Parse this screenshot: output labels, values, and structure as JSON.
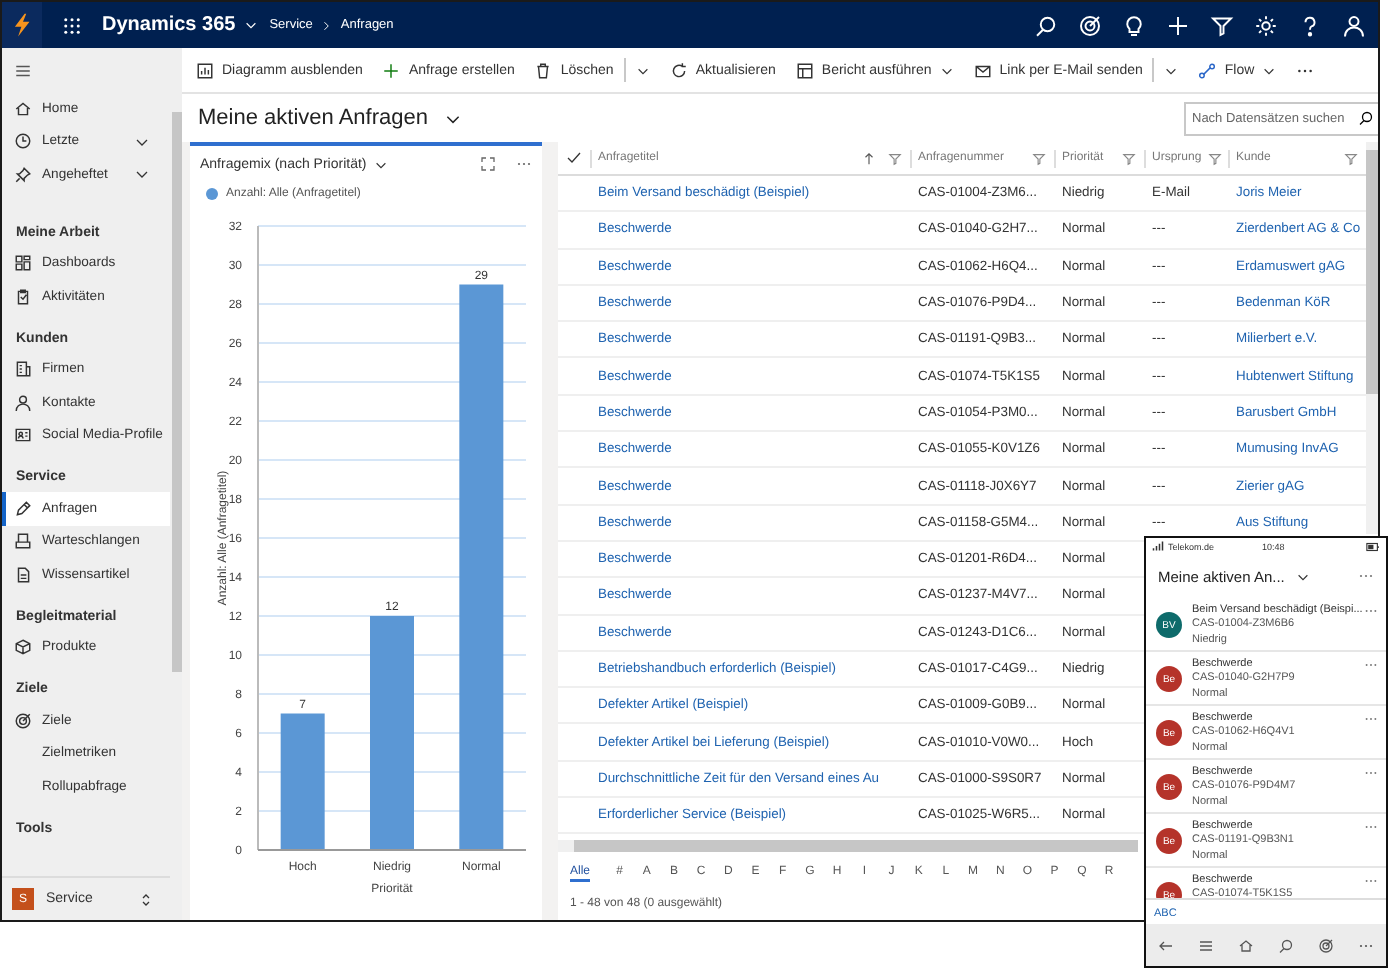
{
  "top_bar": {
    "app_name": "Dynamics 365",
    "breadcrumb": [
      "Service",
      "Anfragen"
    ]
  },
  "sidebar": {
    "top_items": [
      {
        "label": "Home",
        "selected": false
      },
      {
        "label": "Letzte",
        "selected": false,
        "expanded": false
      },
      {
        "label": "Angeheftet",
        "selected": false,
        "expanded": false
      }
    ],
    "groups": [
      {
        "heading": "Meine Arbeit",
        "items": [
          {
            "label": "Dashboards",
            "selected": false
          },
          {
            "label": "Aktivitäten",
            "selected": false
          }
        ]
      },
      {
        "heading": "Kunden",
        "items": [
          {
            "label": "Firmen",
            "selected": false
          },
          {
            "label": "Kontakte",
            "selected": false
          },
          {
            "label": "Social Media-Profile",
            "selected": false
          }
        ]
      },
      {
        "heading": "Service",
        "items": [
          {
            "label": "Anfragen",
            "selected": true
          },
          {
            "label": "Warteschlangen",
            "selected": false
          },
          {
            "label": "Wissensartikel",
            "selected": false
          }
        ]
      },
      {
        "heading": "Begleitmaterial",
        "items": [
          {
            "label": "Produkte",
            "selected": false
          }
        ]
      },
      {
        "heading": "Ziele",
        "items": [
          {
            "label": "Ziele",
            "selected": false
          },
          {
            "label": "Zielmetriken",
            "selected": false
          },
          {
            "label": "Rollupabfrage",
            "selected": false
          }
        ]
      },
      {
        "heading": "Tools"
      }
    ],
    "area": {
      "badge": "S",
      "label": "Service"
    }
  },
  "command_bar": {
    "items": [
      {
        "label": "Diagramm ausblenden",
        "kind": "button"
      },
      {
        "label": "Anfrage erstellen",
        "kind": "button"
      },
      {
        "label": "Löschen",
        "kind": "split"
      },
      {
        "label": "Aktualisieren",
        "kind": "button"
      },
      {
        "label": "Bericht ausführen",
        "kind": "dropdown"
      },
      {
        "label": "Link per E-Mail senden",
        "kind": "split"
      },
      {
        "label": "Flow",
        "kind": "dropdown"
      }
    ]
  },
  "view": {
    "title": "Meine aktiven Anfragen",
    "search": {
      "placeholder": "Nach Datensätzen suchen"
    }
  },
  "chart": {
    "chart_data": {
      "type": "bar",
      "title": "Anfragemix (nach Priorität)",
      "xlabel": "Priorität",
      "ylabel": "Anzahl: Alle (Anfragetitel)",
      "categories": [
        "Hoch",
        "Niedrig",
        "Normal"
      ],
      "series": [
        {
          "name": "Anzahl: Alle (Anfragetitel)",
          "color": "#5b97d5",
          "values": [
            7,
            12,
            29
          ]
        }
      ],
      "ylim": [
        0,
        32
      ],
      "yticks": [
        0,
        2,
        4,
        6,
        8,
        10,
        12,
        14,
        16,
        18,
        20,
        22,
        24,
        26,
        28,
        30,
        32
      ],
      "data_labels": true,
      "grid": true
    }
  },
  "grid": {
    "columns": [
      {
        "label": "Anfragetitel",
        "kind": "link",
        "sorted": true
      },
      {
        "label": "Anfragenummer",
        "kind": "text",
        "sorted": false
      },
      {
        "label": "Priorität",
        "kind": "text",
        "sorted": false
      },
      {
        "label": "Ursprung",
        "kind": "text",
        "sorted": false
      },
      {
        "label": "Kunde",
        "kind": "link",
        "sorted": false
      }
    ],
    "rows": [
      {
        "cells": [
          "Beim Versand beschädigt (Beispiel)",
          "CAS-01004-Z3M6...",
          "Niedrig",
          "E-Mail",
          "Joris Meier"
        ]
      },
      {
        "cells": [
          "Beschwerde",
          "CAS-01040-G2H7...",
          "Normal",
          "---",
          "Zierdenbert AG & Co"
        ]
      },
      {
        "cells": [
          "Beschwerde",
          "CAS-01062-H6Q4...",
          "Normal",
          "---",
          "Erdamuswert gAG"
        ]
      },
      {
        "cells": [
          "Beschwerde",
          "CAS-01076-P9D4...",
          "Normal",
          "---",
          "Bedenman KöR"
        ]
      },
      {
        "cells": [
          "Beschwerde",
          "CAS-01191-Q9B3...",
          "Normal",
          "---",
          "Milierbert e.V."
        ]
      },
      {
        "cells": [
          "Beschwerde",
          "CAS-01074-T5K1S5",
          "Normal",
          "---",
          "Hubtenwert Stiftung"
        ]
      },
      {
        "cells": [
          "Beschwerde",
          "CAS-01054-P3M0...",
          "Normal",
          "---",
          "Barusbert GmbH"
        ]
      },
      {
        "cells": [
          "Beschwerde",
          "CAS-01055-K0V1Z6",
          "Normal",
          "---",
          "Mumusing InvAG"
        ]
      },
      {
        "cells": [
          "Beschwerde",
          "CAS-01118-J0X6Y7",
          "Normal",
          "---",
          "Zierier gAG"
        ]
      },
      {
        "cells": [
          "Beschwerde",
          "CAS-01158-G5M4...",
          "Normal",
          "---",
          "Aus Stiftung"
        ]
      },
      {
        "cells": [
          "Beschwerde",
          "CAS-01201-R6D4...",
          "Normal"
        ]
      },
      {
        "cells": [
          "Beschwerde",
          "CAS-01237-M4V7...",
          "Normal"
        ]
      },
      {
        "cells": [
          "Beschwerde",
          "CAS-01243-D1C6...",
          "Normal"
        ]
      },
      {
        "cells": [
          "Betriebshandbuch erforderlich (Beispiel)",
          "CAS-01017-C4G9...",
          "Niedrig"
        ]
      },
      {
        "cells": [
          "Defekter Artikel (Beispiel)",
          "CAS-01009-G0B9...",
          "Normal"
        ]
      },
      {
        "cells": [
          "Defekter Artikel bei Lieferung (Beispiel)",
          "CAS-01010-V0W0...",
          "Hoch"
        ]
      },
      {
        "cells": [
          "Durchschnittliche Zeit für den Versand eines Au",
          "CAS-01000-S9S0R7",
          "Normal"
        ]
      },
      {
        "cells": [
          "Erforderlicher Service (Beispiel)",
          "CAS-01025-W6R5...",
          "Normal"
        ]
      }
    ],
    "alphabet": [
      {
        "label": "Alle",
        "selected": true
      },
      {
        "label": "#",
        "selected": false
      },
      {
        "label": "A",
        "selected": false
      },
      {
        "label": "B",
        "selected": false
      },
      {
        "label": "C",
        "selected": false
      },
      {
        "label": "D",
        "selected": false
      },
      {
        "label": "E",
        "selected": false
      },
      {
        "label": "F",
        "selected": false
      },
      {
        "label": "G",
        "selected": false
      },
      {
        "label": "H",
        "selected": false
      },
      {
        "label": "I",
        "selected": false
      },
      {
        "label": "J",
        "selected": false
      },
      {
        "label": "K",
        "selected": false
      },
      {
        "label": "L",
        "selected": false
      },
      {
        "label": "M",
        "selected": false
      },
      {
        "label": "N",
        "selected": false
      },
      {
        "label": "O",
        "selected": false
      },
      {
        "label": "P",
        "selected": false
      },
      {
        "label": "Q",
        "selected": false
      },
      {
        "label": "R",
        "selected": false
      }
    ],
    "status": "1 - 48 von 48 (0 ausgewählt)"
  },
  "phone": {
    "carrier": "Telekom.de",
    "time": "10:48",
    "title": "Meine aktiven An...",
    "items": [
      {
        "initials": "BV",
        "color": "#0e6b6b",
        "title": "Beim Versand beschädigt (Beispi...",
        "number": "CAS-01004-Z3M6B6",
        "priority": "Niedrig"
      },
      {
        "initials": "Be",
        "color": "#b5332a",
        "title": "Beschwerde",
        "number": "CAS-01040-G2H7P9",
        "priority": "Normal"
      },
      {
        "initials": "Be",
        "color": "#b5332a",
        "title": "Beschwerde",
        "number": "CAS-01062-H6Q4V1",
        "priority": "Normal"
      },
      {
        "initials": "Be",
        "color": "#b5332a",
        "title": "Beschwerde",
        "number": "CAS-01076-P9D4M7",
        "priority": "Normal"
      },
      {
        "initials": "Be",
        "color": "#b5332a",
        "title": "Beschwerde",
        "number": "CAS-01191-Q9B3N1",
        "priority": "Normal"
      },
      {
        "initials": "Be",
        "color": "#b5332a",
        "title": "Beschwerde",
        "number": "CAS-01074-T5K1S5"
      }
    ],
    "footer": "ABC"
  }
}
